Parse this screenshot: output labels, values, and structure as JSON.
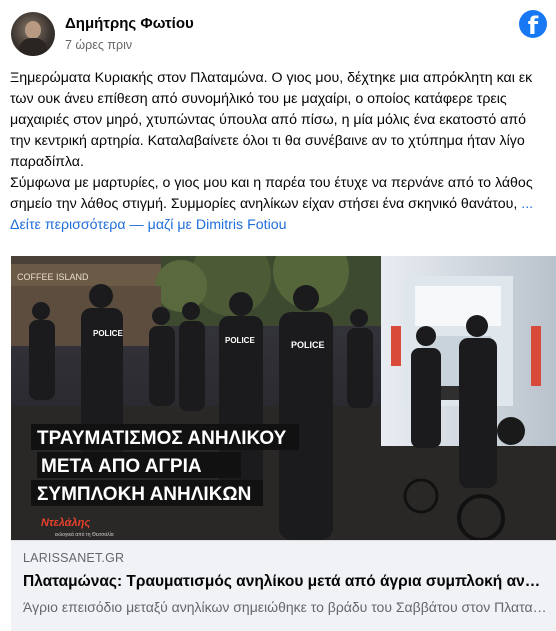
{
  "post": {
    "author": "Δημήτρης Φωτίου",
    "timestamp": "7 ώρες πριν",
    "paragraph1": "Ξημερώματα Κυριακής στον Πλαταμώνα. Ο γιος μου, δέχτηκε μια απρόκλητη και εκ των ουκ άνευ επίθεση από συνομήλικό του με μαχαίρι, ο οποίος κατάφερε τρεις μαχαιριές στον μηρό, χτυπώντας ύπουλα από πίσω, η μία μόλις ένα εκατοστό από την κεντρική αρτηρία. Καταλαβαίνετε όλοι τι θα συνέβαινε αν το χτύπημα ήταν λίγο παραδίπλα.",
    "paragraph2": "Σύμφωνα με μαρτυρίες, ο γιος μου και η παρέα του έτυχε να περνάνε από το λάθος σημείο την λάθος στιγμή. Συμμορίες ανηλίκων είχαν στήσει ένα σκηνικό θανάτου,",
    "see_more": "... Δείτε περισσότερα",
    "with_prefix": "— μαζί με",
    "tagged": "Dimitris Fotiou"
  },
  "image": {
    "overlay_line1": "ΤΡΑΥΜΑΤΙΣΜΟΣ ΑΝΗΛΙΚΟΥ",
    "overlay_line2": "ΜΕΤΑ ΑΠΟ ΑΓΡΙΑ",
    "overlay_line3": "ΣΥΜΠΛΟΚΗ ΑΝΗΛΙΚΩΝ",
    "police_text": "POLICE",
    "shop_sign": "COFFEE ISLAND",
    "watermark": "Ντελάλης",
    "watermark_sub": "εκλογικά από τη Θεσσαλία"
  },
  "link_preview": {
    "domain": "LARISSANET.GR",
    "title": "Πλαταμώνας: Τραυματισμός ανηλίκου μετά από άγρια συμπλοκή ανηλίκων",
    "description": "Άγριο επεισόδιο μεταξύ ανηλίκων σημειώθηκε το βράδυ του Σαββάτου στον Πλαταμώνα"
  },
  "colors": {
    "link": "#216fdb",
    "facebook_blue": "#1877f2",
    "overlay_band": "#111111"
  },
  "icons": {
    "facebook_logo": "facebook-logo-icon"
  }
}
